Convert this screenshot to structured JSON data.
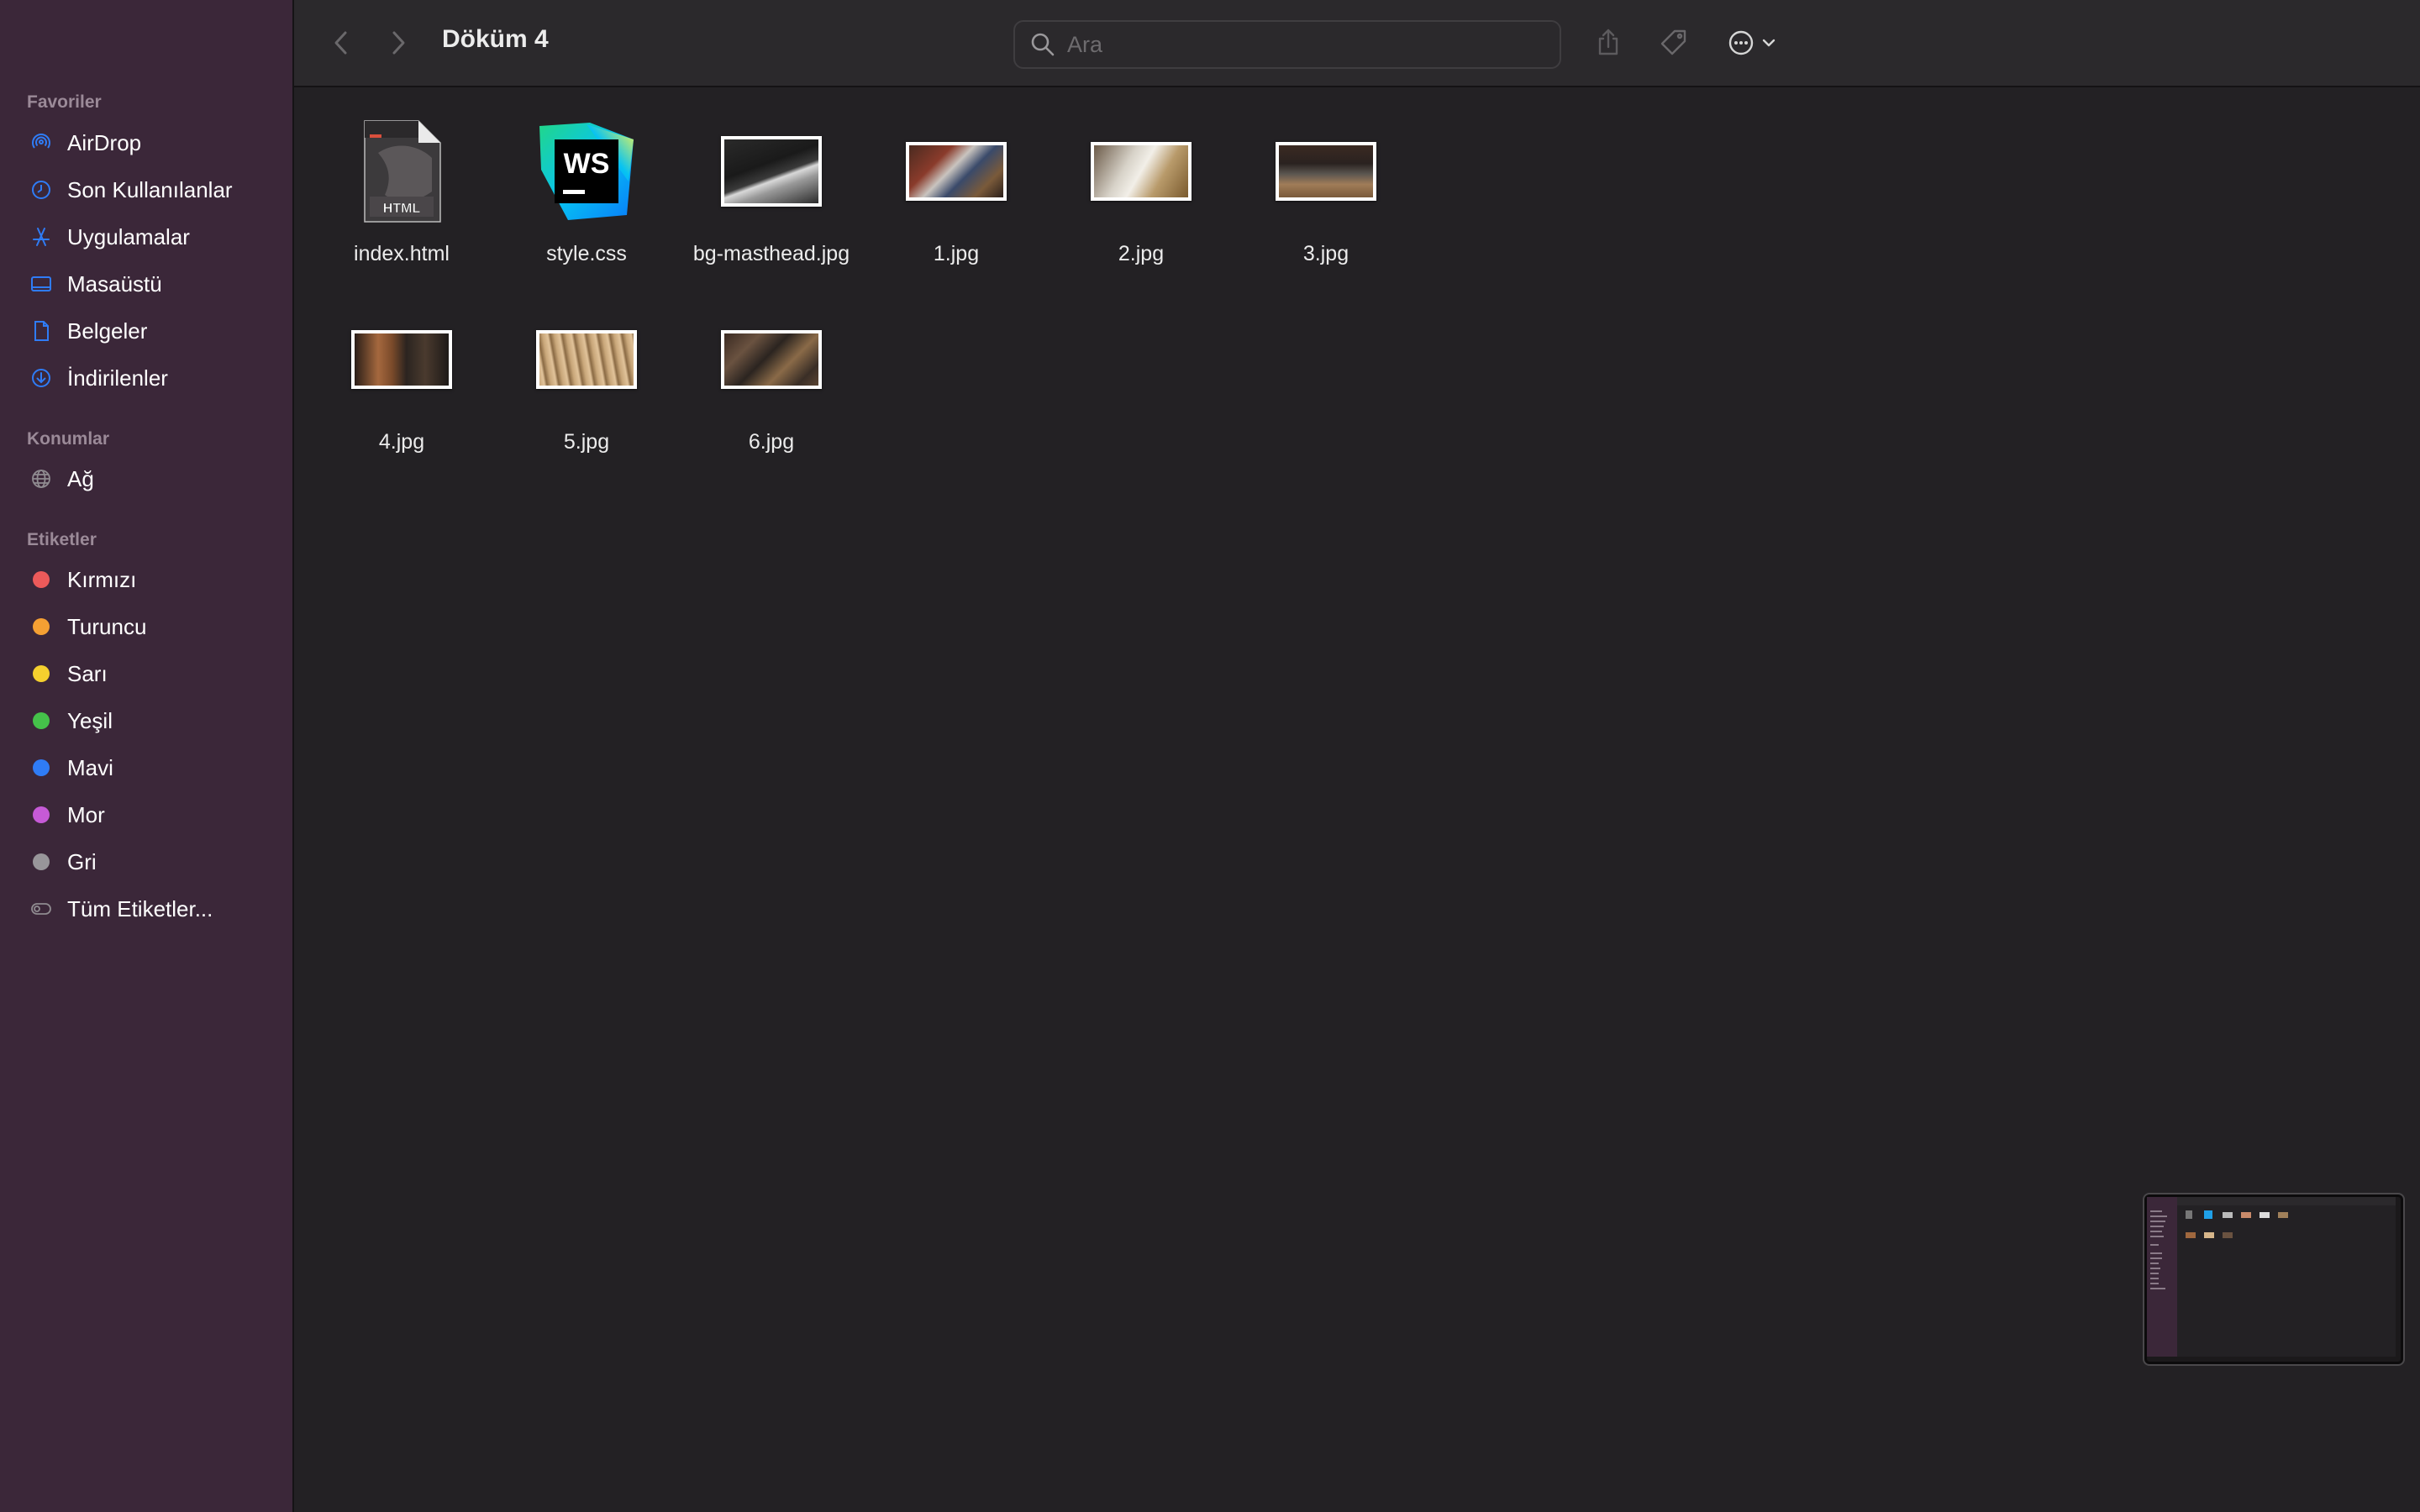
{
  "window": {
    "title": "Döküm 4"
  },
  "sidebar": {
    "sections": [
      {
        "title": "Favoriler",
        "items": [
          {
            "label": "AirDrop",
            "icon": "airdrop-icon"
          },
          {
            "label": "Son Kullanılanlar",
            "icon": "clock-icon"
          },
          {
            "label": "Uygulamalar",
            "icon": "applications-icon"
          },
          {
            "label": "Masaüstü",
            "icon": "desktop-icon"
          },
          {
            "label": "Belgeler",
            "icon": "document-icon"
          },
          {
            "label": "İndirilenler",
            "icon": "download-icon"
          }
        ]
      },
      {
        "title": "Konumlar",
        "items": [
          {
            "label": "Ağ",
            "icon": "network-icon"
          }
        ]
      },
      {
        "title": "Etiketler",
        "items": [
          {
            "label": "Kırmızı",
            "color": "#ec5a5a"
          },
          {
            "label": "Turuncu",
            "color": "#f5a033"
          },
          {
            "label": "Sarı",
            "color": "#f5d02e"
          },
          {
            "label": "Yeşil",
            "color": "#45c14a"
          },
          {
            "label": "Mavi",
            "color": "#2f7cf6"
          },
          {
            "label": "Mor",
            "color": "#c65ad7"
          },
          {
            "label": "Gri",
            "color": "#98969a"
          },
          {
            "label": "Tüm Etiketler...",
            "icon": "all-tags-icon"
          }
        ]
      }
    ]
  },
  "toolbar": {
    "search_placeholder": "Ara",
    "accent_color": "#2f7cf6"
  },
  "files": [
    {
      "name": "index.html",
      "kind": "html"
    },
    {
      "name": "style.css",
      "kind": "css"
    },
    {
      "name": "bg-masthead.jpg",
      "kind": "image"
    },
    {
      "name": "1.jpg",
      "kind": "image"
    },
    {
      "name": "2.jpg",
      "kind": "image"
    },
    {
      "name": "3.jpg",
      "kind": "image"
    },
    {
      "name": "4.jpg",
      "kind": "image"
    },
    {
      "name": "5.jpg",
      "kind": "image"
    },
    {
      "name": "6.jpg",
      "kind": "image"
    }
  ],
  "icon_badges": {
    "html": "HTML",
    "css": "WS"
  }
}
